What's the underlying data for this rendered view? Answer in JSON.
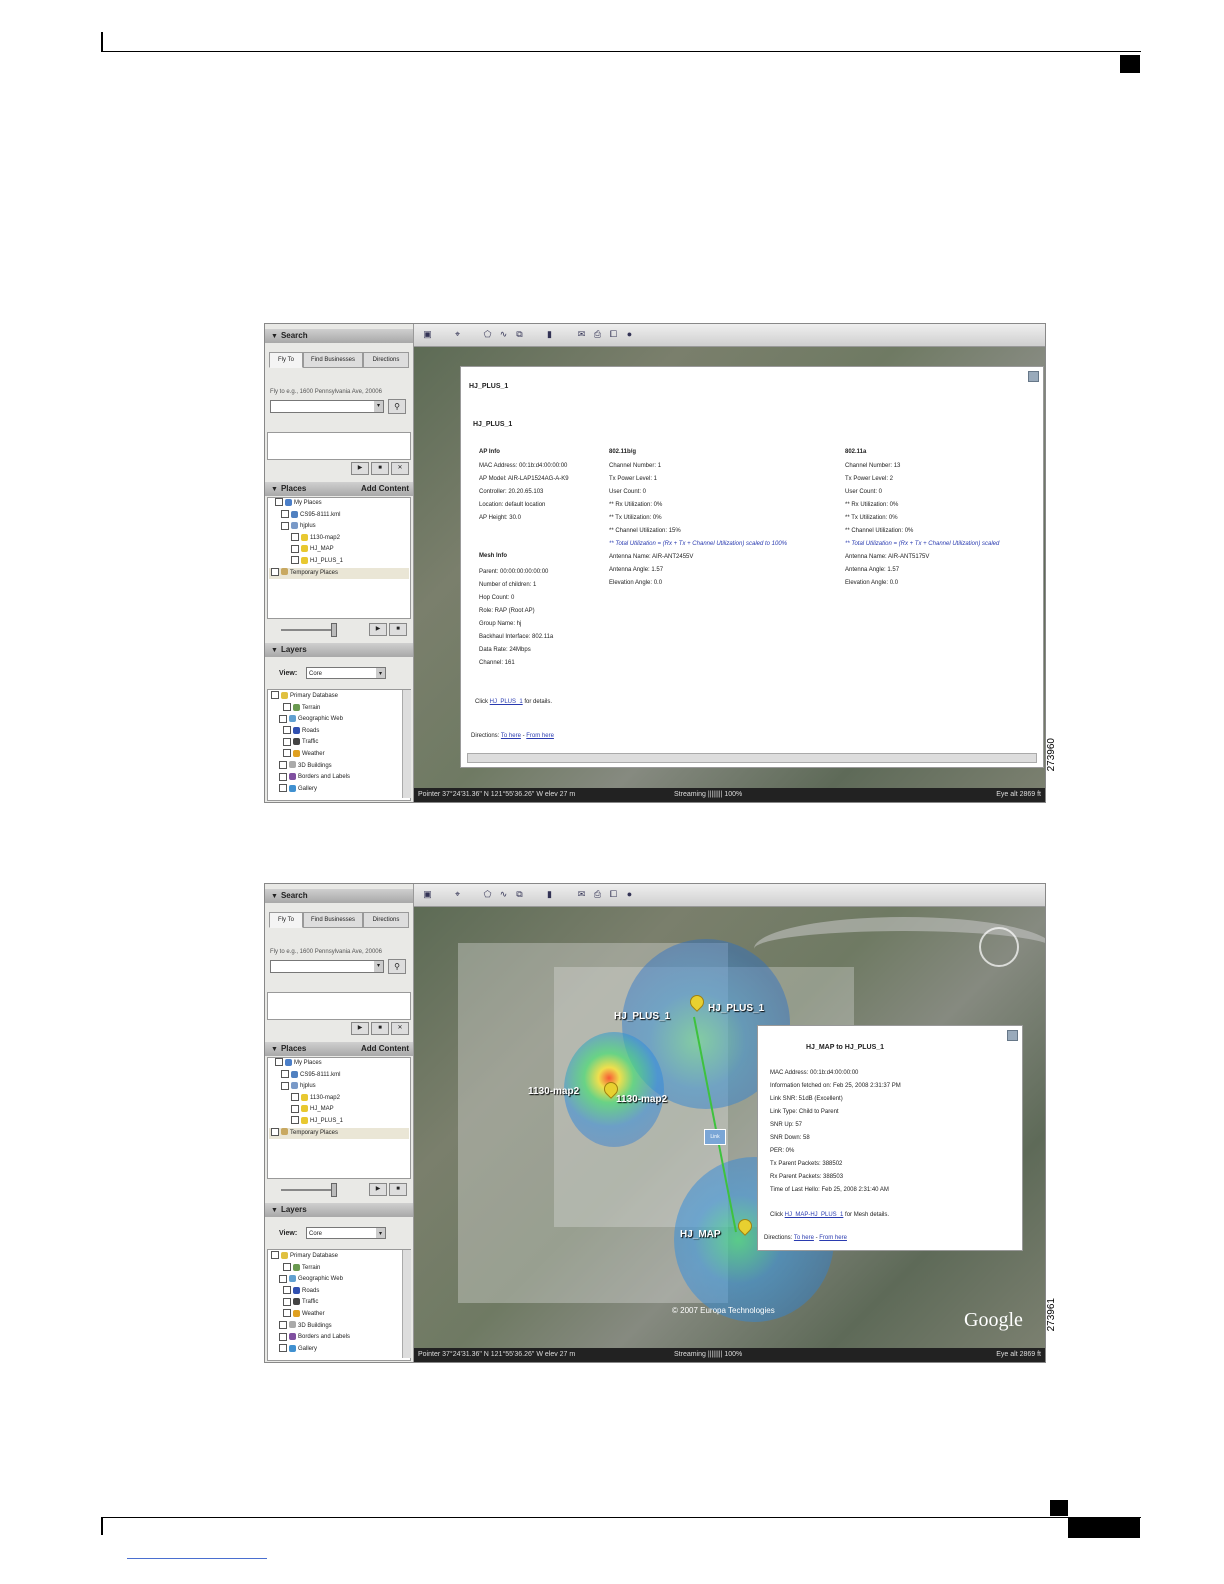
{
  "figure_ids": [
    "273960",
    "273961"
  ],
  "left_panel": {
    "search_title": "Search",
    "tabs": [
      "Fly To",
      "Find Businesses",
      "Directions"
    ],
    "fly_to_hint": "Fly to e.g., 1600 Pennsylvania Ave, 20006",
    "places_title": "Places",
    "add_content": "Add Content",
    "places_tree": [
      "My Places",
      "CS95-8111.kml",
      "hjplus",
      "1130-map2",
      "HJ_MAP",
      "HJ_PLUS_1",
      "Temporary Places"
    ],
    "layers_title": "Layers",
    "view_label": "View:",
    "view_value": "Core",
    "layers_tree": [
      "Primary Database",
      "Terrain",
      "Geographic Web",
      "Roads",
      "Traffic",
      "Weather",
      "3D Buildings",
      "Borders and Labels",
      "Gallery"
    ]
  },
  "status_bar": {
    "pointer": "Pointer 37°24'31.36\" N 121°55'36.26\" W elev 27 m",
    "streaming": "Streaming |||||||| 100%",
    "eye_alt": "Eye alt 2869 ft"
  },
  "shot1": {
    "title": "HJ_PLUS_1",
    "subtitle": "HJ_PLUS_1",
    "ap_info_head": "AP Info",
    "ap_info": [
      "MAC Address: 00:1b:d4:00:00:00",
      "AP Model: AIR-LAP1524AG-A-K9",
      "Controller: 20.20.65.103",
      "Location: default location",
      "AP Height: 30.0"
    ],
    "mesh_info_head": "Mesh Info",
    "mesh_info": [
      "Parent: 00:00:00:00:00:00",
      "Number of children: 1",
      "Hop Count: 0",
      "Role: RAP (Root AP)",
      "Group Name: hj",
      "Backhaul Interface: 802.11a",
      "Data Rate: 24Mbps",
      "Channel: 161"
    ],
    "bg_head": "802.11b/g",
    "bg_info": [
      "Channel Number: 1",
      "Tx Power Level: 1",
      "User Count: 0",
      "** Rx Utilization: 0%",
      "** Tx Utilization: 0%",
      "** Channel Utilization: 15%"
    ],
    "bg_note": "** Total Utilization = (Rx + Tx + Channel Utilization) scaled to 100%",
    "bg_info2": [
      "Antenna Name: AIR-ANT2455V",
      "Antenna Angle: 1.57",
      "Elevation Angle: 0.0"
    ],
    "a_head": "802.11a",
    "a_info": [
      "Channel Number: 13",
      "Tx Power Level: 2",
      "User Count: 0",
      "** Rx Utilization: 0%",
      "** Tx Utilization: 0%",
      "** Channel Utilization: 0%"
    ],
    "a_note": "** Total Utilization = (Rx + Tx + Channel Utilization) scaled",
    "a_info2": [
      "Antenna Name: AIR-ANT5175V",
      "Antenna Angle: 1.57",
      "Elevation Angle: 0.0"
    ],
    "click_prefix": "Click ",
    "click_link": "HJ_PLUS_1",
    "click_suffix": " for details.",
    "directions_label": "Directions: ",
    "to_here": "To here",
    "from_here": "From here"
  },
  "shot2": {
    "labels": [
      "HJ_PLUS_1",
      "HJ_PLUS_1",
      "1130-map2",
      "1130-map2",
      "HJ_MAP"
    ],
    "copyright": "© 2007 Europa Technologies",
    "google": "Google",
    "link_box": "Link",
    "balloon_title": "HJ_MAP to HJ_PLUS_1",
    "balloon_lines": [
      "MAC Address: 00:1b:d4:00:00:00",
      "Information fetched on: Feb 25, 2008 2:31:37 PM",
      "Link SNR: 51dB (Excellent)",
      "Link Type: Child to Parent",
      "SNR Up: 57",
      "SNR Down: 58",
      "PER: 0%",
      "Tx Parent Packets: 388502",
      "Rx Parent Packets: 388503",
      "Time of Last Hello: Feb 25, 2008 2:31:40 AM"
    ],
    "click_prefix": "Click ",
    "click_link": "HJ_MAP-HJ_PLUS_1",
    "click_suffix": " for Mesh details.",
    "directions_label": "Directions: ",
    "to_here": "To here",
    "from_here": "From here"
  }
}
